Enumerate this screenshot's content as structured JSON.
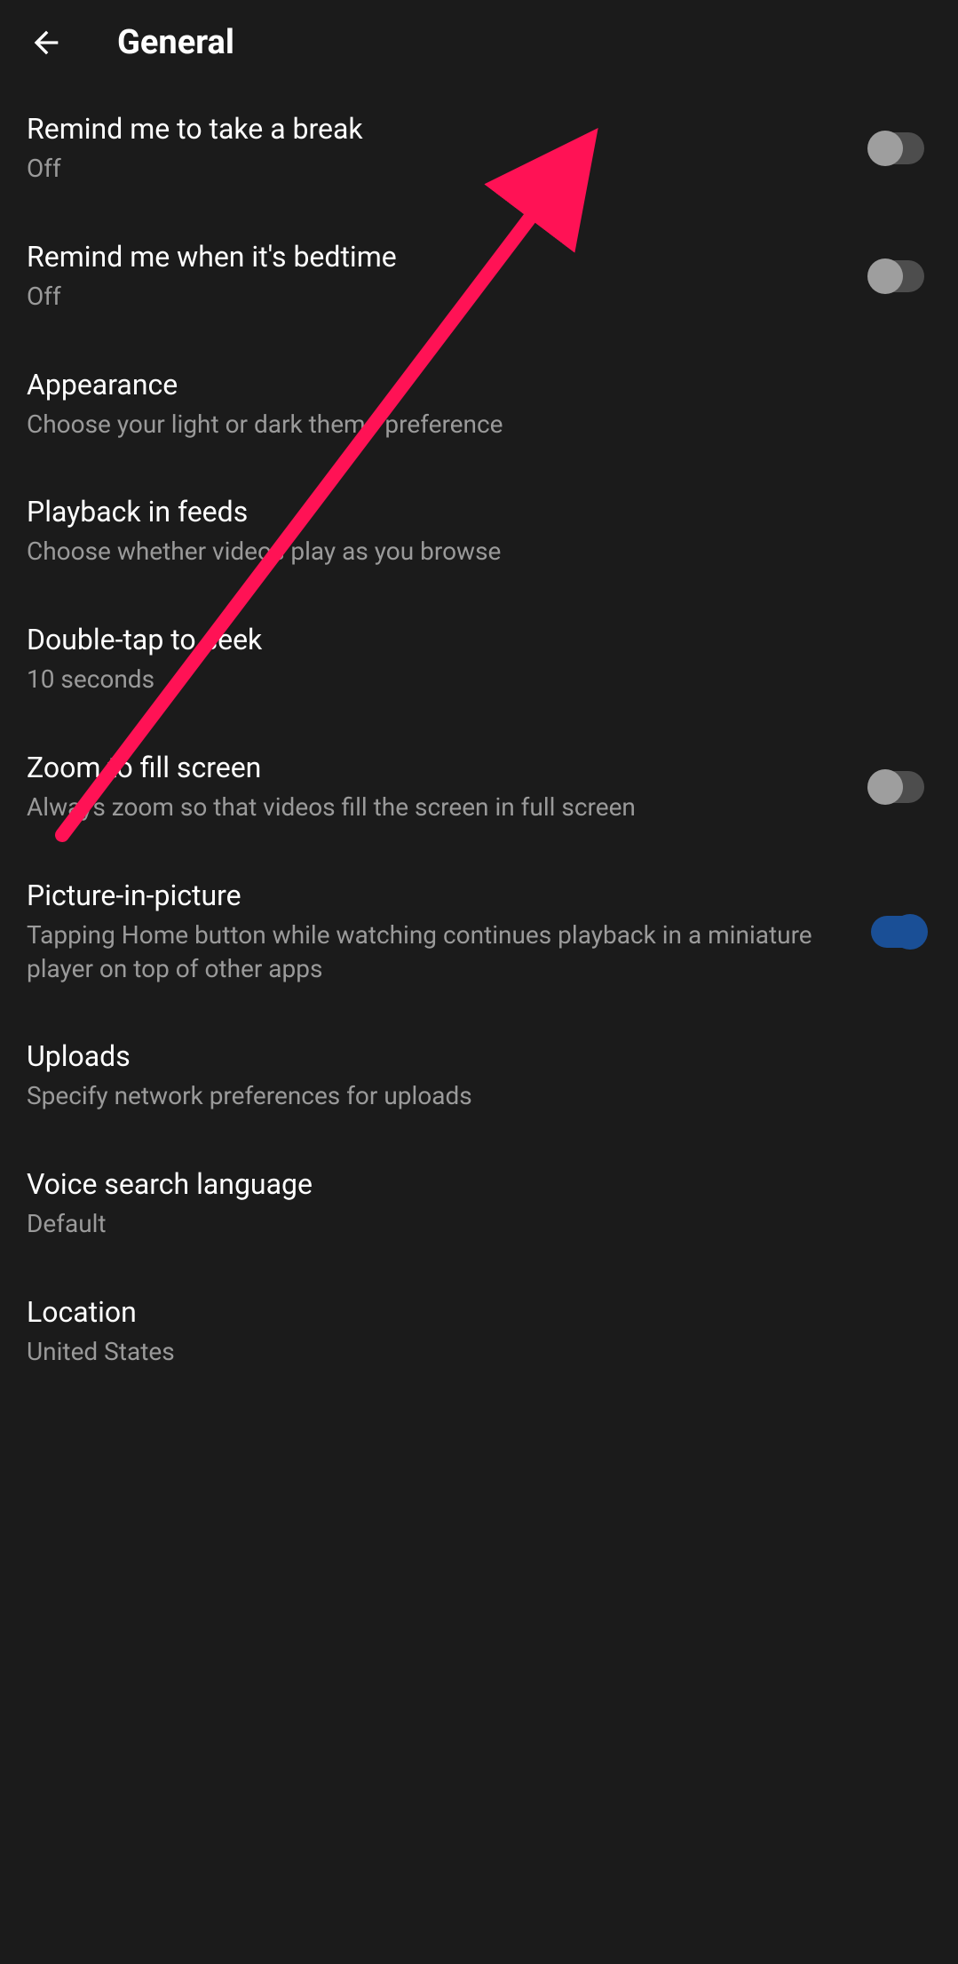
{
  "header": {
    "title": "General"
  },
  "rows": [
    {
      "title": "Remind me to take a break",
      "sub": "Off"
    },
    {
      "title": "Remind me when it's bedtime",
      "sub": "Off"
    },
    {
      "title": "Appearance",
      "sub": "Choose your light or dark theme preference"
    },
    {
      "title": "Playback in feeds",
      "sub": "Choose whether videos play as you browse"
    },
    {
      "title": "Double-tap to seek",
      "sub": "10 seconds"
    },
    {
      "title": "Zoom to fill screen",
      "sub": "Always zoom so that videos fill the screen in full screen"
    },
    {
      "title": "Picture-in-picture",
      "sub": "Tapping Home button while watching continues playback in a miniature player on top of other apps"
    },
    {
      "title": "Uploads",
      "sub": "Specify network preferences for uploads"
    },
    {
      "title": "Voice search language",
      "sub": "Default"
    },
    {
      "title": "Location",
      "sub": "United States"
    }
  ]
}
